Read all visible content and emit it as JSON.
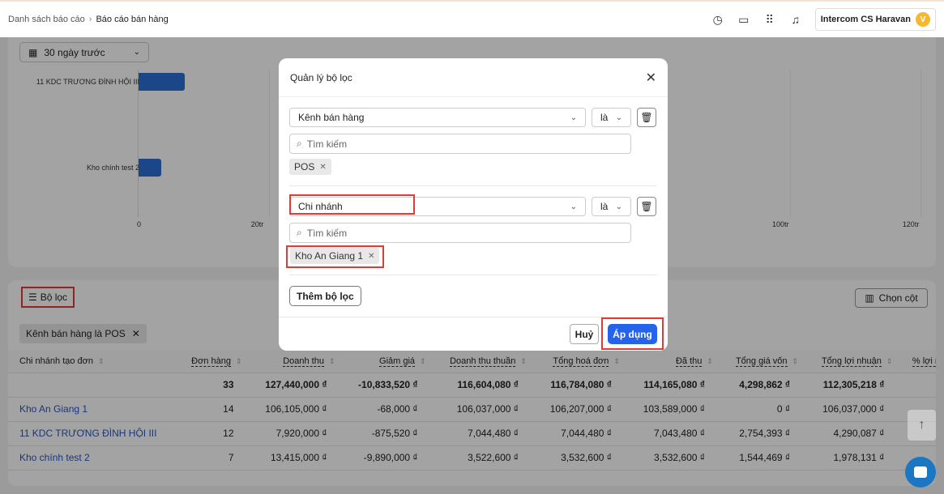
{
  "breadcrumb": {
    "parent": "Danh sách báo cáo",
    "current": "Báo cáo bán hàng"
  },
  "account": {
    "name": "Intercom CS Haravan",
    "initial": "V"
  },
  "date_filter": "30 ngày trước",
  "chart_data": {
    "type": "bar",
    "orientation": "horizontal",
    "categories": [
      "11 KDC TRƯƠNG ĐÌNH HỘI III",
      "Kho chính test 2"
    ],
    "values": [
      7.04,
      3.52
    ],
    "unit": "tr",
    "x_ticks": [
      "0",
      "20tr",
      "100tr",
      "120tr"
    ],
    "xlim": [
      0,
      120
    ]
  },
  "toolbar": {
    "filter_label": "Bộ lọc",
    "columns_label": "Chọn cột",
    "active_chip": "Kênh bán hàng là POS"
  },
  "table": {
    "headers": [
      "Chi nhánh tạo đơn",
      "Đơn hàng",
      "Doanh thu",
      "Giảm giá",
      "Doanh thu thuần",
      "Tổng hoá đơn",
      "Đã thu",
      "Tổng giá vốn",
      "Tổng lợi nhuận",
      "% lợi n"
    ],
    "rows": [
      [
        "",
        "33",
        "127,440,000 ₫",
        "-10,833,520 ₫",
        "116,604,080 ₫",
        "116,784,080 ₫",
        "114,165,080 ₫",
        "4,298,862 ₫",
        "112,305,218 ₫",
        ""
      ],
      [
        "Kho An Giang 1",
        "14",
        "106,105,000 ₫",
        "-68,000 ₫",
        "106,037,000 ₫",
        "106,207,000 ₫",
        "103,589,000 ₫",
        "0 ₫",
        "106,037,000 ₫",
        ""
      ],
      [
        "11 KDC TRƯƠNG ĐÌNH HỘI III",
        "12",
        "7,920,000 ₫",
        "-875,520 ₫",
        "7,044,480 ₫",
        "7,044,480 ₫",
        "7,043,480 ₫",
        "2,754,393 ₫",
        "4,290,087 ₫",
        ""
      ],
      [
        "Kho chính test 2",
        "7",
        "13,415,000 ₫",
        "-9,890,000 ₫",
        "3,522,600 ₫",
        "3,532,600 ₫",
        "3,532,600 ₫",
        "1,544,469 ₫",
        "1,978,131 ₫",
        ""
      ]
    ]
  },
  "modal": {
    "title": "Quản lý bộ lọc",
    "filters": [
      {
        "field": "Kênh bán hàng",
        "operator": "là",
        "search_placeholder": "Tìm kiếm",
        "tags": [
          "POS"
        ]
      },
      {
        "field": "Chi nhánh",
        "operator": "là",
        "search_placeholder": "Tìm kiếm",
        "tags": [
          "Kho An Giang 1"
        ]
      }
    ],
    "add_filter": "Thêm bộ lọc",
    "cancel": "Huỷ",
    "apply": "Áp dụng"
  }
}
